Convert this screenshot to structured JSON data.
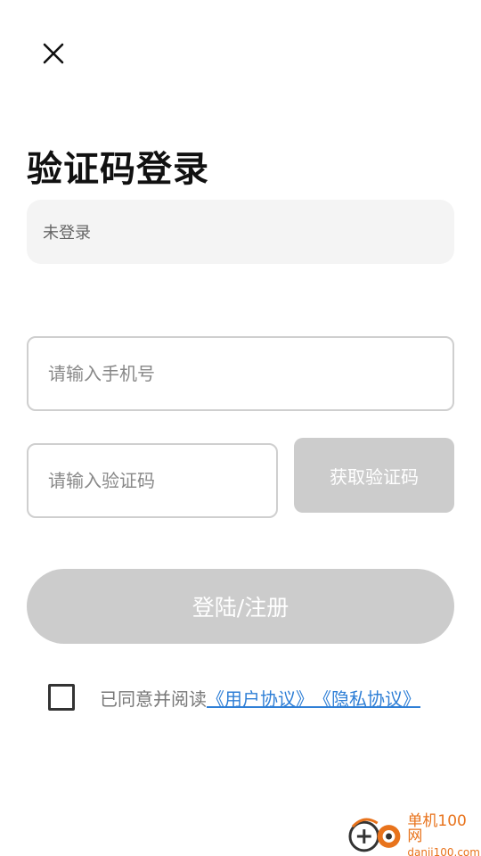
{
  "header": {
    "close_icon": "close-icon"
  },
  "title": "验证码登录",
  "status": {
    "text": "未登录"
  },
  "phone_input": {
    "placeholder": "请输入手机号",
    "value": ""
  },
  "code_input": {
    "placeholder": "请输入验证码",
    "value": ""
  },
  "get_code_button": {
    "label": "获取验证码"
  },
  "login_button": {
    "label": "登陆/注册"
  },
  "agreement": {
    "checked": false,
    "prefix": "已同意并阅读",
    "user_agreement": "《用户协议》",
    "privacy_policy": "《隐私协议》"
  },
  "watermark": {
    "brand_cn": "单机100网",
    "brand_url": "danji100.com"
  },
  "colors": {
    "link": "#2f7fd6",
    "disabled_button": "#cccccc",
    "watermark": "#e8731c"
  }
}
